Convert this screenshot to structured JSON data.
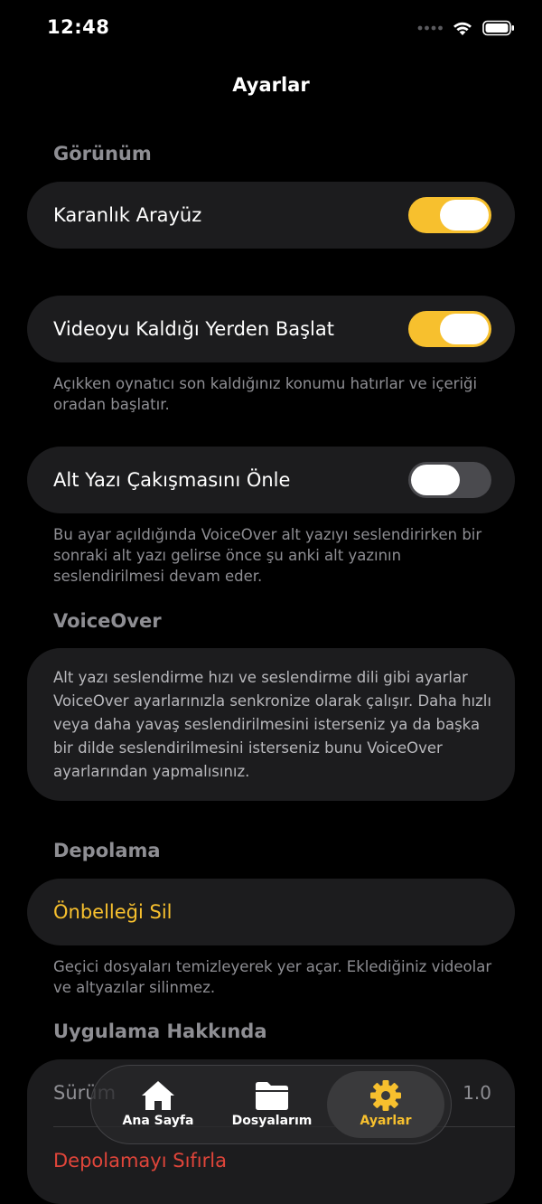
{
  "status_bar": {
    "time": "12:48",
    "icons": [
      "signal-dots-icon",
      "wifi-icon",
      "battery-icon"
    ]
  },
  "nav": {
    "title": "Ayarlar"
  },
  "appearance": {
    "header": "Görünüm",
    "dark_ui_label": "Karanlık Arayüz",
    "dark_ui_on": true
  },
  "resume": {
    "label": "Videoyu Kaldığı Yerden Başlat",
    "on": true,
    "footnote": "Açıkken oynatıcı son kaldığınız konumu hatırlar ve içeriği oradan başlatır."
  },
  "subtitle_overlap": {
    "label": "Alt Yazı Çakışmasını Önle",
    "on": false,
    "footnote": "Bu ayar açıldığında VoiceOver alt yazıyı seslendirirken bir sonraki alt yazı gelirse önce şu anki alt yazının seslendirilmesi devam eder."
  },
  "voiceover": {
    "header": "VoiceOver",
    "text": "Alt yazı seslendirme hızı ve seslendirme dili gibi ayarlar VoiceOver ayarlarınızla senkronize olarak çalışır. Daha hızlı veya daha yavaş seslendirilmesini isterseniz ya da başka bir dilde seslendirilmesini isterseniz bunu VoiceOver ayarlarından yapmalısınız."
  },
  "storage": {
    "header": "Depolama",
    "clear_cache_label": "Önbelleği Sil",
    "footnote": "Geçici dosyaları temizleyerek yer açar. Eklediğiniz videolar ve altyazılar silinmez."
  },
  "about": {
    "header": "Uygulama Hakkında",
    "version_label": "Sürüm",
    "version_value": "1.0",
    "reset_storage_label": "Depolamayı Sıfırla"
  },
  "tab_bar": {
    "tabs": [
      {
        "label": "Ana Sayfa",
        "icon": "home-icon",
        "active": false
      },
      {
        "label": "Dosyalarım",
        "icon": "folder-icon",
        "active": false
      },
      {
        "label": "Ayarlar",
        "icon": "gear-icon",
        "active": true
      }
    ]
  },
  "colors": {
    "accent": "#f7c02e",
    "destructive": "#e0453a",
    "card": "#1c1c1e",
    "background": "#000000"
  }
}
